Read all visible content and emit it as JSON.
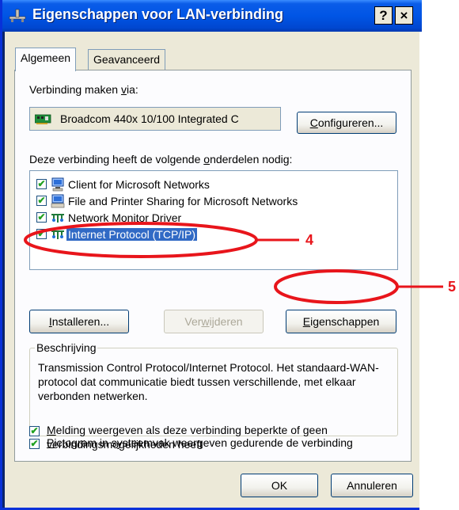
{
  "window": {
    "title": "Eigenschappen voor LAN-verbinding",
    "help_label": "?",
    "close_label": "×"
  },
  "tabs": [
    {
      "label": "Algemeen"
    },
    {
      "label": "Geavanceerd"
    }
  ],
  "connect_via": {
    "label_pre": "Verbinding maken ",
    "label_mnemonic": "v",
    "label_post": "ia:",
    "adapter_name": "Broadcom 440x 10/100 Integrated C",
    "configure_mnemonic": "C",
    "configure_rest": "onfigureren..."
  },
  "components": {
    "label_pre": "Deze verbinding heeft de volgende ",
    "label_mnemonic": "o",
    "label_post": "nderdelen nodig:",
    "items": [
      {
        "label": "Client for Microsoft Networks",
        "checked": true,
        "icon": "network-client-icon",
        "selected": false
      },
      {
        "label": "File and Printer Sharing for Microsoft Networks",
        "checked": true,
        "icon": "file-printer-sharing-icon",
        "selected": false
      },
      {
        "label": "Network Monitor Driver",
        "checked": true,
        "icon": "protocol-icon",
        "selected": false
      },
      {
        "label": "Internet Protocol (TCP/IP)",
        "checked": true,
        "icon": "protocol-icon",
        "selected": true
      }
    ]
  },
  "buttons": {
    "install_mnemonic": "I",
    "install_rest": "nstalleren...",
    "remove_pre": "Ver",
    "remove_mnemonic": "w",
    "remove_post": "ijderen",
    "properties_mnemonic": "E",
    "properties_rest": "igenschappen",
    "ok": "OK",
    "cancel": "Annuleren"
  },
  "description": {
    "legend": "Beschrijving",
    "text": "Transmission Control Protocol/Internet Protocol. Het standaard-WAN-protocol dat communicatie biedt tussen verschillende, met elkaar verbonden netwerken."
  },
  "options": [
    {
      "mnemonic": "P",
      "rest": "ictogram in systeemvak weergeven gedurende de verbinding",
      "checked": true
    },
    {
      "mnemonic": "M",
      "rest": "elding weergeven als deze verbinding beperkte of geen verbindingsmogelijkheden heeft",
      "checked": true
    }
  ],
  "annotations": [
    {
      "number": "4"
    },
    {
      "number": "5"
    }
  ],
  "colors": {
    "annotation": "#e8151b",
    "titlebar": "#0055e5",
    "selection": "#316ac5"
  }
}
